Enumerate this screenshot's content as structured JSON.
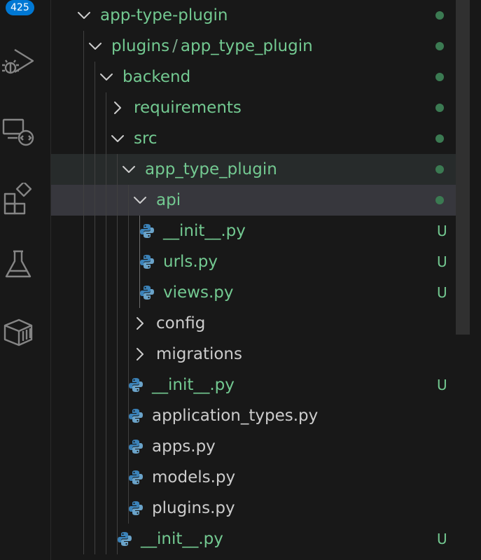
{
  "activity_bar": {
    "badge_count": "425",
    "icons": [
      "run-debug-icon",
      "remote-explorer-icon",
      "extensions-icon",
      "testing-icon",
      "containers-icon"
    ]
  },
  "explorer": {
    "rows": [
      {
        "label": "app-type-plugin",
        "kind": "folder-open",
        "depth": 0,
        "color": "green",
        "decoration": "dot"
      },
      {
        "label_a": "plugins",
        "label_sep": "/",
        "label_b": "app_type_plugin",
        "kind": "folder-open-compact",
        "depth": 1,
        "color": "green",
        "decoration": "dot"
      },
      {
        "label": "backend",
        "kind": "folder-open",
        "depth": 2,
        "color": "green",
        "decoration": "dot"
      },
      {
        "label": "requirements",
        "kind": "folder-closed",
        "depth": 3,
        "color": "green",
        "decoration": "dot"
      },
      {
        "label": "src",
        "kind": "folder-open",
        "depth": 3,
        "color": "green",
        "decoration": "dot"
      },
      {
        "label": "app_type_plugin",
        "kind": "folder-open",
        "depth": 4,
        "color": "green",
        "decoration": "dot",
        "highlight": "hover"
      },
      {
        "label": "api",
        "kind": "folder-open",
        "depth": 5,
        "color": "green",
        "decoration": "dot",
        "highlight": "selected"
      },
      {
        "label": "__init__.py",
        "kind": "python-file",
        "depth": 6,
        "color": "green",
        "status": "U"
      },
      {
        "label": "urls.py",
        "kind": "python-file",
        "depth": 6,
        "color": "green",
        "status": "U"
      },
      {
        "label": "views.py",
        "kind": "python-file",
        "depth": 6,
        "color": "green",
        "status": "U"
      },
      {
        "label": "config",
        "kind": "folder-closed",
        "depth": 5,
        "color": "gray"
      },
      {
        "label": "migrations",
        "kind": "folder-closed",
        "depth": 5,
        "color": "gray"
      },
      {
        "label": "__init__.py",
        "kind": "python-file",
        "depth": 5,
        "color": "green",
        "status": "U"
      },
      {
        "label": "application_types.py",
        "kind": "python-file",
        "depth": 5,
        "color": "gray"
      },
      {
        "label": "apps.py",
        "kind": "python-file",
        "depth": 5,
        "color": "gray"
      },
      {
        "label": "models.py",
        "kind": "python-file",
        "depth": 5,
        "color": "gray"
      },
      {
        "label": "plugins.py",
        "kind": "python-file",
        "depth": 5,
        "color": "gray"
      },
      {
        "label": "__init__.py",
        "kind": "python-file",
        "depth": 4,
        "color": "green",
        "status": "U"
      }
    ]
  },
  "colors": {
    "git_untracked": "#73c991",
    "default_text": "#cccccc",
    "python_blue": "#3b82b8",
    "python_yellow": "#6aa3c9"
  }
}
